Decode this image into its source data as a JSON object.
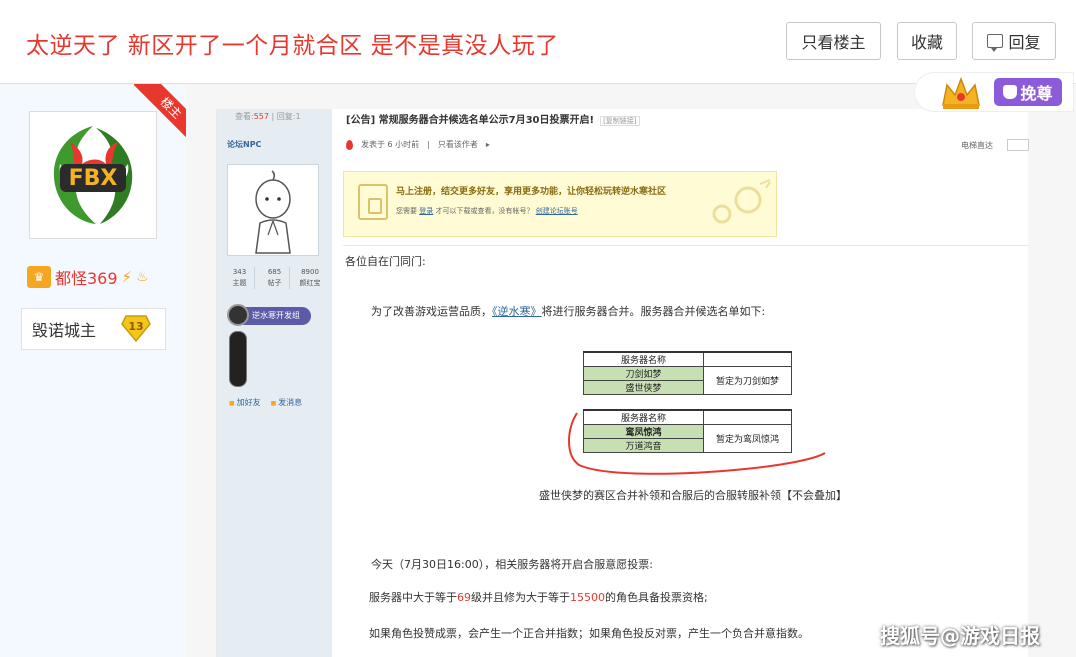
{
  "header": {
    "title": "太逆天了 新区开了一个月就合区 是不是真没人玩了",
    "btn_only_owner": "只看楼主",
    "btn_favorite": "收藏",
    "btn_reply": "回复"
  },
  "owner_badge": "楼主",
  "user": {
    "name": "都怪369",
    "rank_title": "毁诺城主",
    "level": "13",
    "avatar_text": "FBX"
  },
  "badge_wanzun": "挽尊",
  "screenshot": {
    "views_label": "查看:",
    "views_value": "557",
    "replies_label": "回复:",
    "replies_value": "1",
    "npc_name": "论坛NPC",
    "stats": [
      {
        "value": "343",
        "label": "主题"
      },
      {
        "value": "685",
        "label": "帖子"
      },
      {
        "value": "8900",
        "label": "颜红宝"
      }
    ],
    "dev_tag": "逆水寒开发组",
    "link_add_friend": "加好友",
    "link_message": "发消息",
    "post_title": "[公告] 常规服务器合并候选名单公示7月30日投票开启!",
    "copy_link": "[复制链接]",
    "posted_time": "发表于 6 小时前",
    "only_author": "只看该作者",
    "floor_label": "电梯直达",
    "notice_main": "马上注册，结交更多好友，享用更多功能，让你轻松玩转逆水寒社区",
    "notice_sub_prefix": "您需要",
    "notice_login": "登录",
    "notice_sub_mid": "才可以下载或查看，没有帐号？",
    "notice_register": "创建论坛账号",
    "greeting": "各位自在门同门:",
    "p1_a": "为了改善游戏运营品质，",
    "p1_link": "《逆水寒》",
    "p1_b": "将进行服务器合并。服务器合并候选名单如下:",
    "table1": {
      "header": "服务器名称",
      "rows": [
        "刀剑如梦",
        "盛世侠梦"
      ],
      "result": "暂定为刀剑如梦"
    },
    "table2": {
      "header": "服务器名称",
      "rows": [
        "鸾凤惊鸿",
        "万道鸿音"
      ],
      "result": "暂定为鸾凤惊鸿"
    },
    "p2": "盛世侠梦的赛区合并补领和合服后的合服转服补领【不会叠加】",
    "p3": "今天（7月30日16:00），相关服务器将开启合服意愿投票:",
    "p4_a": "服务器中大于等于",
    "p4_lvl": "69",
    "p4_b": "级并且修为大于等于",
    "p4_xiuwei": "15500",
    "p4_c": "的角色具备投票资格;",
    "p5": "如果角色投赞成票，会产生一个正合并指数；如果角色投反对票，产生一个负合并意指数。"
  },
  "watermark": "搜狐号@游戏日报",
  "colors": {
    "accent_red": "#e8382e",
    "vip_gold": "#f5a623",
    "wanzun_purple": "#8b5bd9",
    "table_green": "#c6e0b4"
  }
}
